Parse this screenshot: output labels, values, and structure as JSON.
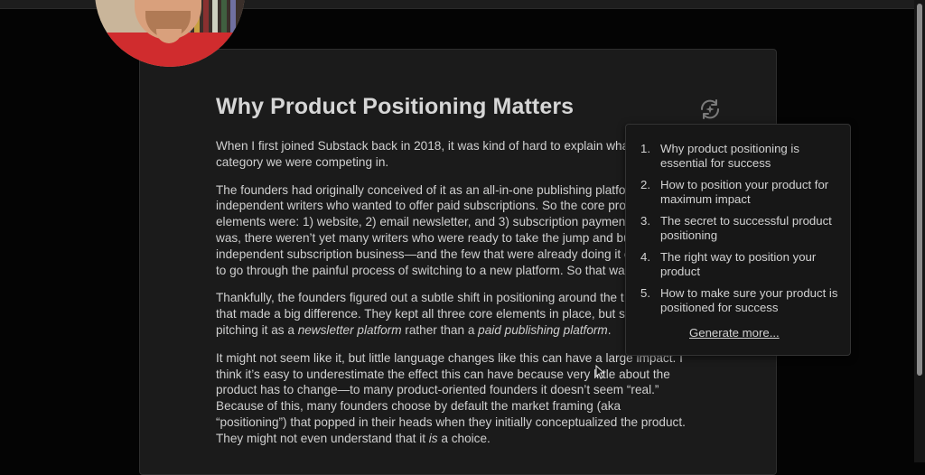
{
  "document": {
    "title": "Why Product Positioning Matters",
    "paragraphs": [
      {
        "lines": [
          "When I first joined Substack back in 2018, it was kind of hard to explain wha",
          "category we were competing in."
        ]
      },
      {
        "lines": [
          "The founders had originally conceived of it as an all-in-one publishing platfo",
          "independent writers who wanted to offer paid subscriptions. So the core pro",
          "elements were: 1) website, 2) email newsletter, and 3) subscription payment",
          "was, there weren’t yet many writers who were ready to take the jump and bu",
          "independent subscription business—and the few that were already doing it c",
          "to go through the painful process of switching to a new platform. So that wa"
        ]
      },
      {
        "l1": "Thankfully, the founders figured out a subtle shift in positioning around the t",
        "l2": "that made a big difference. They kept all three core elements in place, but st",
        "l3a": "pitching it as a ",
        "l3b": "newsletter platform",
        "l3c": " rather than a ",
        "l3d": "paid publishing platform",
        "l3e": "."
      },
      {
        "l1": "It might not seem like it, but little language changes like this can have a large impact. I",
        "l2": "think it’s easy to underestimate the effect this can have because very little about the",
        "l3": "product has to change—to many product-oriented founders it doesn’t seem “real.”",
        "l4": "Because of this, many founders choose by default the market framing (aka",
        "l5": "“positioning”) that popped in their heads when they initially conceptualized the product.",
        "l6a": "They might not even understand that it ",
        "l6b": "is",
        "l6c": " a choice."
      }
    ]
  },
  "suggestions": {
    "items": [
      {
        "num": "1.",
        "text": "Why product positioning is essential for success"
      },
      {
        "num": "2.",
        "text": "How to position your product for maximum impact"
      },
      {
        "num": "3.",
        "text": "The secret to successful product positioning"
      },
      {
        "num": "4.",
        "text": "The right way to position your product"
      },
      {
        "num": "5.",
        "text": "How to make sure your product is positioned for success"
      }
    ],
    "generate_more": "Generate more..."
  },
  "icons": {
    "regenerate": "refresh-sparkle-icon",
    "cursor": "arrow-cursor-icon"
  }
}
